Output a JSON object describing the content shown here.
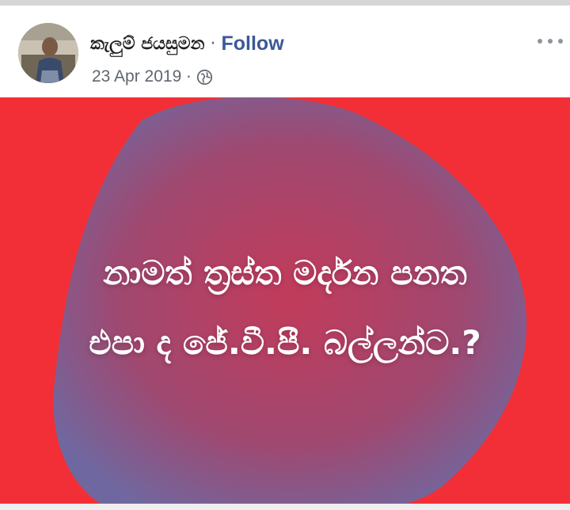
{
  "post": {
    "author_name": "කැලුම් ජයසුමන",
    "separator": "·",
    "follow_label": "Follow",
    "date": "23 Apr 2019",
    "meta_separator": "·",
    "privacy_icon": "globe-icon",
    "more_icon": "more-options-icon"
  },
  "image": {
    "line_1": "නාමත් ත්‍රස්ත මර්දන පනත",
    "line_2": "එපා ද ජේ.වී.පී. බල්ලන්ට.?",
    "background_color": "#f22f36",
    "blob_color": "#8a5b88"
  },
  "colors": {
    "link": "#3b5998",
    "meta_text": "#606770",
    "name_text": "#1c1e21"
  }
}
